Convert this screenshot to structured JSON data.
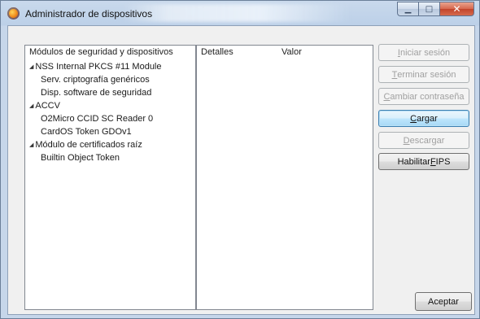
{
  "window": {
    "title": "Administrador de dispositivos",
    "controls": [
      "minimize-icon",
      "maximize-icon",
      "close-icon"
    ]
  },
  "tree": {
    "header": "Módulos de seguridad y dispositivos",
    "items": [
      {
        "label": "NSS Internal PKCS #11 Module",
        "level": 0,
        "expanded": true
      },
      {
        "label": "Serv. criptografía genéricos",
        "level": 1
      },
      {
        "label": "Disp. software de seguridad",
        "level": 1
      },
      {
        "label": "ACCV",
        "level": 0,
        "expanded": true
      },
      {
        "label": "O2Micro CCID SC Reader 0",
        "level": 1
      },
      {
        "label": "CardOS Token GDOv1",
        "level": 1
      },
      {
        "label": "Módulo de certificados raíz",
        "level": 0,
        "expanded": true
      },
      {
        "label": "Builtin Object Token",
        "level": 1
      }
    ]
  },
  "details": {
    "col_details": "Detalles",
    "col_value": "Valor"
  },
  "buttons": {
    "login": {
      "mnemonic": "I",
      "rest": "niciar sesión",
      "enabled": false
    },
    "logout": {
      "mnemonic": "T",
      "rest": "erminar sesión",
      "enabled": false
    },
    "change_password": {
      "mnemonic": "C",
      "rest": "ambiar contraseña",
      "enabled": false
    },
    "load": {
      "mnemonic": "C",
      "rest": "argar",
      "enabled": true,
      "focused": true
    },
    "unload": {
      "mnemonic": "D",
      "rest": "escargar",
      "enabled": false
    },
    "fips_prefix": "Habilitar ",
    "fips_mnemonic": "F",
    "fips_rest": "IPS",
    "ok": "Aceptar"
  }
}
